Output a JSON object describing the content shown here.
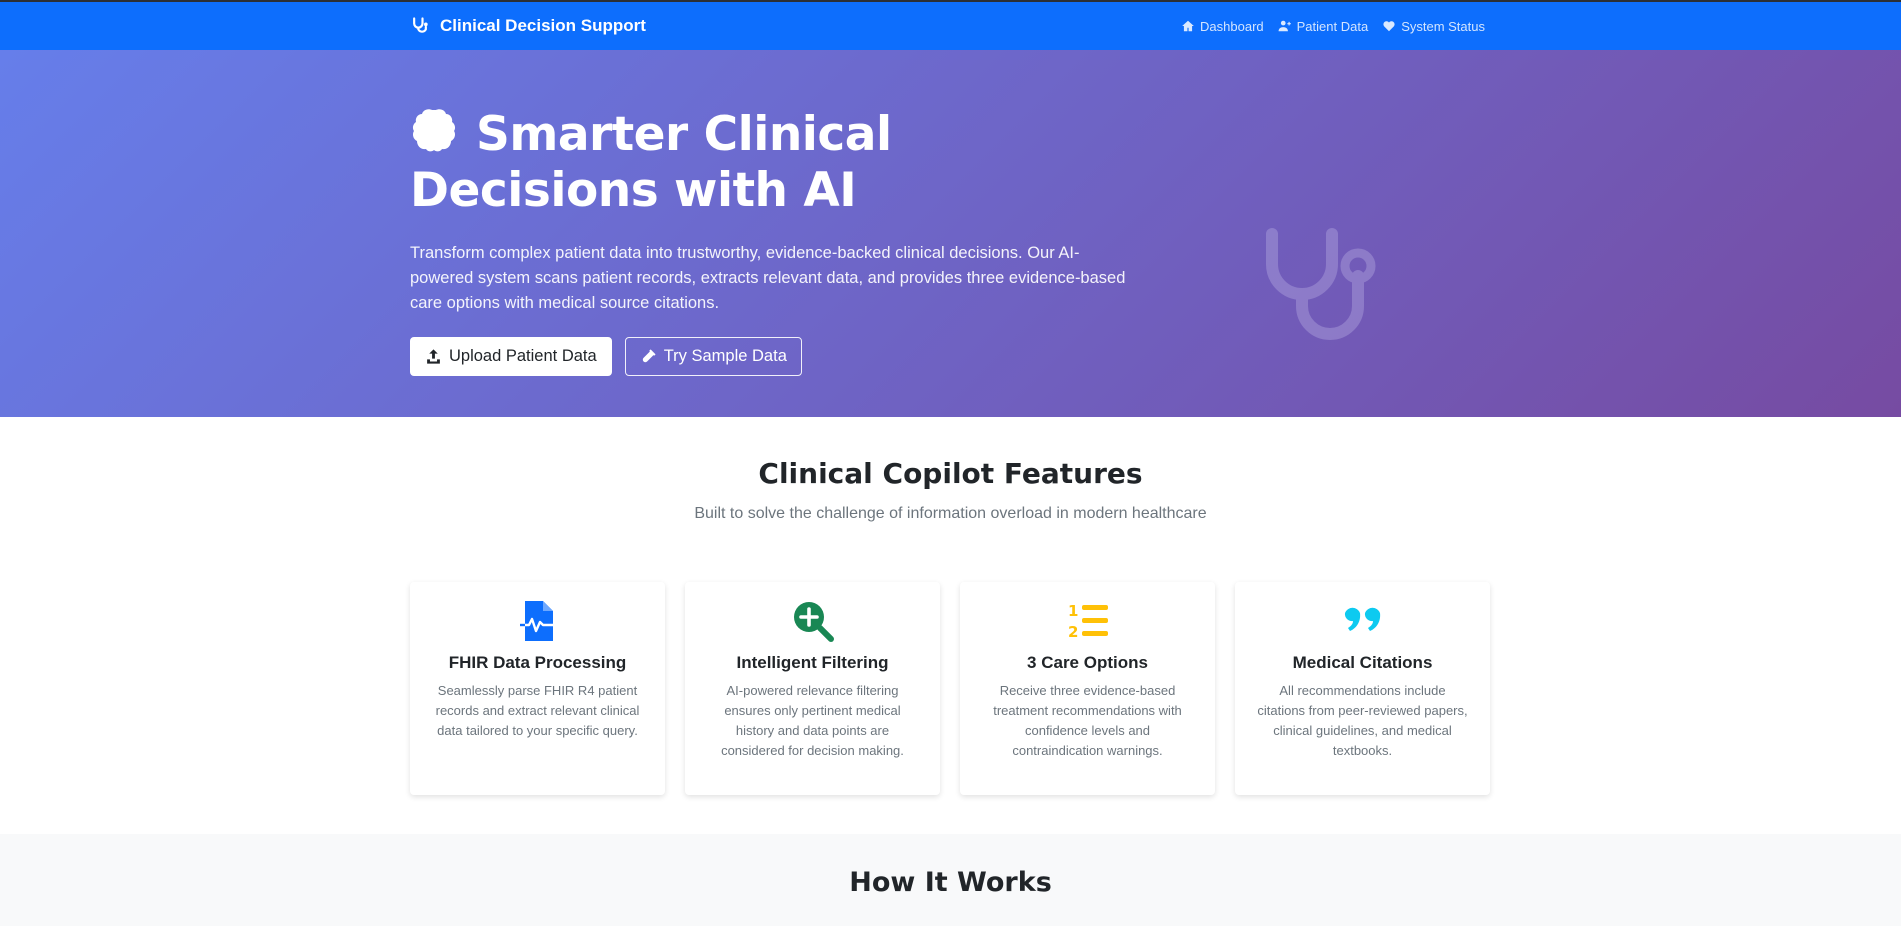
{
  "navbar": {
    "brand": "Clinical Decision Support",
    "links": [
      {
        "label": "Dashboard",
        "icon": "home-icon"
      },
      {
        "label": "Patient Data",
        "icon": "user-plus-icon"
      },
      {
        "label": "System Status",
        "icon": "heart-icon"
      }
    ]
  },
  "hero": {
    "title": "Smarter Clinical Decisions with AI",
    "title_icon": "brain-icon",
    "description": "Transform complex patient data into trustworthy, evidence-backed clinical decisions. Our AI-powered system scans patient records, extracts relevant data, and provides three evidence-based care options with medical source citations.",
    "upload_button": "Upload Patient Data",
    "sample_button": "Try Sample Data",
    "decor_icon": "stethoscope-icon"
  },
  "features": {
    "title": "Clinical Copilot Features",
    "subtitle": "Built to solve the challenge of information overload in modern healthcare",
    "cards": [
      {
        "title": "FHIR Data Processing",
        "text": "Seamlessly parse FHIR R4 patient records and extract relevant clinical data tailored to your specific query.",
        "icon": "file-medical-icon",
        "color": "#0d6efd"
      },
      {
        "title": "Intelligent Filtering",
        "text": "AI-powered relevance filtering ensures only pertinent medical history and data points are considered for decision making.",
        "icon": "search-plus-icon",
        "color": "#198754"
      },
      {
        "title": "3 Care Options",
        "text": "Receive three evidence-based treatment recommendations with confidence levels and contraindication warnings.",
        "icon": "list-ol-icon",
        "color": "#ffc107"
      },
      {
        "title": "Medical Citations",
        "text": "All recommendations include citations from peer-reviewed papers, clinical guidelines, and medical textbooks.",
        "icon": "quote-icon",
        "color": "#0dcaf0"
      }
    ]
  },
  "how": {
    "title": "How It Works"
  },
  "colors": {
    "navbar": "#0d6efd",
    "hero_start": "#667eea",
    "hero_end": "#764ba2"
  }
}
